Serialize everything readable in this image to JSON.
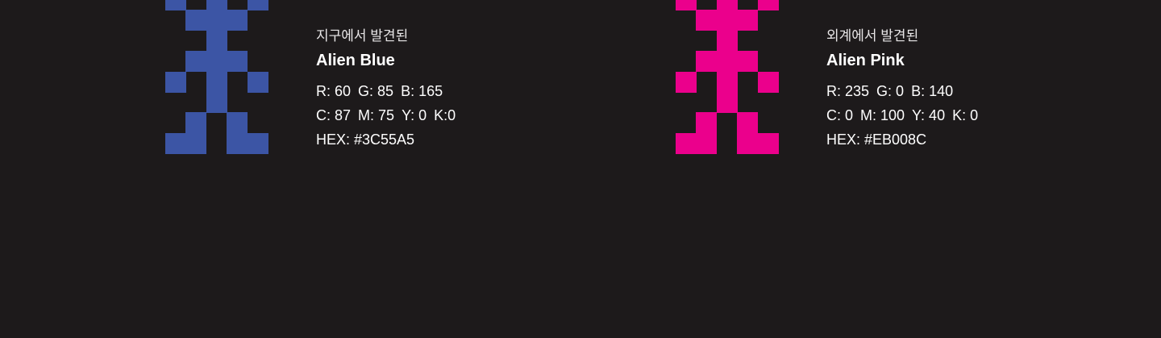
{
  "swatches": [
    {
      "id": "blue",
      "subtitle": "지구에서 발견된",
      "name": "Alien Blue",
      "color": "#3C55A5",
      "rgb": [
        "R: 60",
        "G: 85",
        "B: 165"
      ],
      "cmyk": [
        "C: 87",
        "M: 75",
        "Y: 0",
        "K:0"
      ],
      "hex": "HEX: #3C55A5",
      "icon": "pixel-alien-icon"
    },
    {
      "id": "pink",
      "subtitle": "외계에서 발견된",
      "name": "Alien Pink",
      "color": "#EB008C",
      "rgb": [
        "R: 235",
        "G: 0",
        "B: 140"
      ],
      "cmyk": [
        "C: 0",
        "M: 100",
        "Y: 40",
        "K: 0"
      ],
      "hex": "HEX: #EB008C",
      "icon": "pixel-alien-icon"
    }
  ]
}
